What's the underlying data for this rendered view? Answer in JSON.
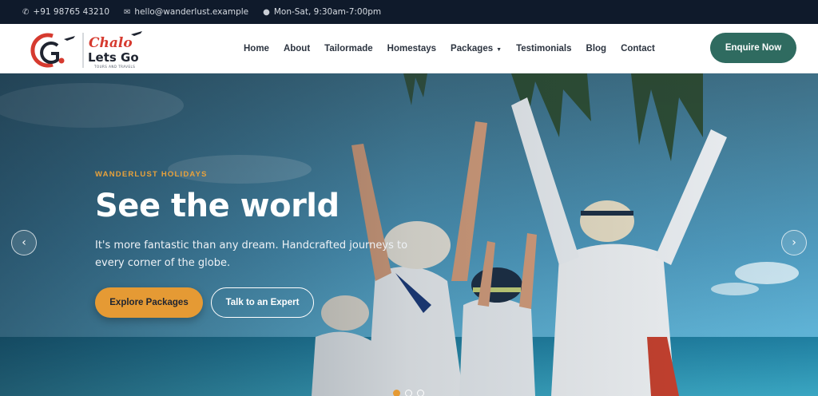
{
  "topbar": {
    "phone": "+91 98765 43210",
    "email": "hello@wanderlust.example",
    "hours": "Mon-Sat, 9:30am-7:00pm"
  },
  "brand": {
    "line1": "Chalo",
    "line2": "Lets Go",
    "tagline": "TOURS AND TRAVELS"
  },
  "nav": {
    "items": [
      "Home",
      "About",
      "Tailormade",
      "Homestays",
      "Packages",
      "Testimonials",
      "Blog",
      "Contact"
    ],
    "cta": "Enquire Now"
  },
  "hero": {
    "eyebrow": "WANDERLUST HOLIDAYS",
    "title": "See the world",
    "subtitle": "It's more fantastic than any dream. Handcrafted journeys to every corner of the globe.",
    "primary_cta": "Explore Packages",
    "secondary_cta": "Talk to an Expert",
    "slides": 3,
    "active_slide": 0
  },
  "colors": {
    "topbar_bg": "#0f1a2b",
    "accent_orange": "#e59a34",
    "cta_green": "#2f6b60",
    "brand_red": "#d63a2f"
  },
  "icons": {
    "phone": "phone-icon",
    "email": "mail-icon",
    "hours": "clock-icon",
    "prev": "chevron-left-icon",
    "next": "chevron-right-icon"
  }
}
